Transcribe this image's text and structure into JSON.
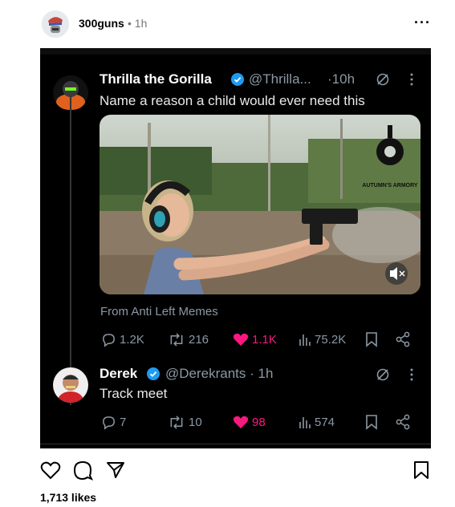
{
  "post": {
    "username": "300guns",
    "time": "1h",
    "separator": "•",
    "more": "···",
    "likes": "1,713 likes"
  },
  "tweets": [
    {
      "name": "Thrilla the Gorilla",
      "handle": "@Thrilla...",
      "time": "·10h",
      "text": "Name a reason a child would ever need this",
      "source": "From Anti Left Memes",
      "watermark": "AUTUMN'S ARMORY",
      "stats": {
        "replies": "1.2K",
        "reposts": "216",
        "likes": "1.1K",
        "views": "75.2K"
      }
    },
    {
      "name": "Derek",
      "handle": "@Derekrants · 1h",
      "text": "Track meet",
      "stats": {
        "replies": "7",
        "reposts": "10",
        "likes": "98",
        "views": "574"
      }
    }
  ],
  "colors": {
    "like_active": "#f91880",
    "verified": "#1d9bf0",
    "muted": "#8b98a5",
    "background": "#000000"
  },
  "icons": [
    "more-icon",
    "verified-icon",
    "grok-icon",
    "reply-icon",
    "repost-icon",
    "heart-icon",
    "views-icon",
    "bookmark-icon",
    "share-icon",
    "mute-icon",
    "ig-heart-icon",
    "ig-comment-icon",
    "ig-send-icon",
    "ig-save-icon"
  ]
}
